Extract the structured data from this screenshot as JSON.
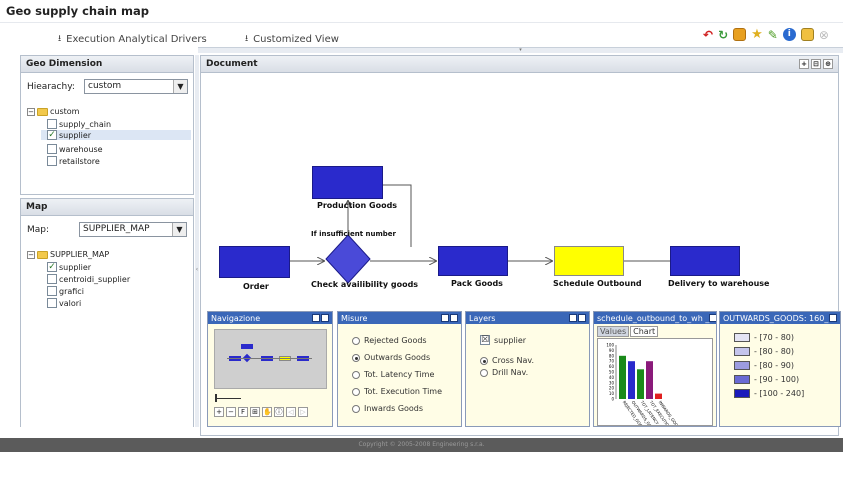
{
  "app": {
    "title": "Geo supply chain map"
  },
  "menu": {
    "execution_drivers": "Execution Analytical Drivers",
    "customized_view": "Customized View"
  },
  "toolbar_icons": [
    "undo-icon",
    "refresh-icon",
    "export-icon",
    "favorite-star-icon",
    "edit-icon",
    "info-icon",
    "print-icon",
    "close-icon"
  ],
  "geo_dimension": {
    "header": "Geo Dimension",
    "hierarchy_label": "Hiearachy:",
    "hierarchy_value": "custom",
    "root": "custom",
    "items": [
      {
        "label": "supply_chain",
        "checked": false
      },
      {
        "label": "supplier",
        "checked": true
      },
      {
        "label": "warehouse",
        "checked": false
      },
      {
        "label": "retailstore",
        "checked": false
      }
    ]
  },
  "map_panel": {
    "header": "Map",
    "map_label": "Map:",
    "map_value": "SUPPLIER_MAP",
    "root": "SUPPLIER_MAP",
    "items": [
      {
        "label": "supplier",
        "checked": true
      },
      {
        "label": "centroidi_supplier",
        "checked": false
      },
      {
        "label": "grafici",
        "checked": false
      },
      {
        "label": "valori",
        "checked": false
      }
    ]
  },
  "document": {
    "header": "Document",
    "nodes": {
      "order": "Order",
      "check": "Check availibility goods",
      "production": "Production Goods",
      "insufficient": "If insufficient number",
      "pack": "Pack Goods",
      "schedule": "Schedule Outbound",
      "delivery": "Delivery to warehouse"
    }
  },
  "navigazione": {
    "title": "Navigazione"
  },
  "misure": {
    "title": "Misure",
    "options": [
      {
        "label": "Rejected Goods",
        "selected": false
      },
      {
        "label": "Outwards Goods",
        "selected": true
      },
      {
        "label": "Tot. Latency Time",
        "selected": false
      },
      {
        "label": "Tot. Execution Time",
        "selected": false
      },
      {
        "label": "Inwards Goods",
        "selected": false
      }
    ]
  },
  "layers": {
    "title": "Layers",
    "checkbox": "supplier",
    "options": [
      {
        "label": "Cross Nav.",
        "selected": true
      },
      {
        "label": "Drill Nav.",
        "selected": false
      }
    ]
  },
  "schedule_chart": {
    "title": "schedule_outbound_to_wh _",
    "tab_values": "Values",
    "tab_chart": "Chart"
  },
  "chart_data": {
    "type": "bar",
    "categories": [
      "REJECTED_GOODS",
      "OUTWARDS_GOODS",
      "TOT_LATENCY_TIME",
      "TOT_EXECUTION_TIME",
      "INWARDS_GOODS"
    ],
    "values": [
      80,
      70,
      55,
      70,
      10
    ],
    "colors": [
      "#1a8a1a",
      "#2a2acc",
      "#1a8a1a",
      "#8a1a7a",
      "#e02020"
    ],
    "ylim": [
      0,
      100
    ],
    "yticks": [
      "100",
      "90",
      "80",
      "70",
      "60",
      "50",
      "40",
      "30",
      "20",
      "10",
      "0"
    ]
  },
  "outwards_legend": {
    "title": "OUTWARDS_GOODS: 160_",
    "items": [
      {
        "label": "- [70 - 80)",
        "color": "#e4e4f4"
      },
      {
        "label": "- [80 - 80)",
        "color": "#c4c4ec"
      },
      {
        "label": "- [80 - 90)",
        "color": "#9c9ce0"
      },
      {
        "label": "- [90 - 100)",
        "color": "#6a6ad4"
      },
      {
        "label": "- [100 - 240]",
        "color": "#1a1abb"
      }
    ]
  },
  "footer": {
    "copyright": "Copyright © 2005-2008 Engineering s.r.a."
  }
}
